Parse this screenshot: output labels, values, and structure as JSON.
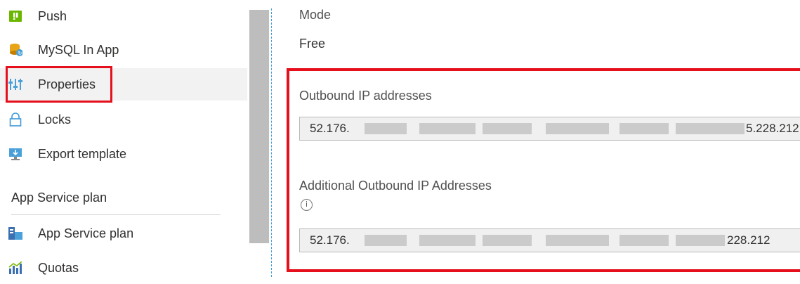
{
  "sidebar": {
    "items": [
      {
        "label": "Push",
        "icon": "push-icon"
      },
      {
        "label": "MySQL In App",
        "icon": "mysql-icon"
      },
      {
        "label": "Properties",
        "icon": "properties-icon",
        "selected": true
      },
      {
        "label": "Locks",
        "icon": "lock-icon"
      },
      {
        "label": "Export template",
        "icon": "export-template-icon"
      }
    ],
    "section_header": "App Service plan",
    "section_items": [
      {
        "label": "App Service plan",
        "icon": "app-service-plan-icon"
      },
      {
        "label": "Quotas",
        "icon": "quotas-icon"
      }
    ]
  },
  "main": {
    "mode": {
      "label": "Mode",
      "value": "Free"
    },
    "outbound": {
      "label": "Outbound IP addresses",
      "value_start": "52.176.",
      "value_end": "5.228.212"
    },
    "additional": {
      "label": "Additional Outbound IP Addresses",
      "value_start": "52.176.",
      "value_end": "228.212",
      "info_icon": "info-icon"
    }
  },
  "colors": {
    "highlight": "#e5101b",
    "accent": "#3c9ad8",
    "selected_bg": "#f2f2f2"
  }
}
